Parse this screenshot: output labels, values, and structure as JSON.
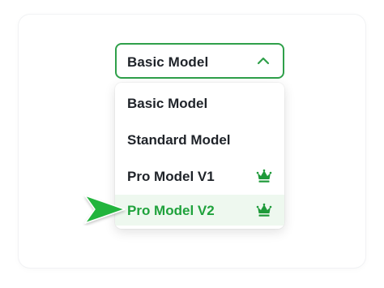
{
  "colors": {
    "accent": "#2fa04a",
    "selected_text": "#1fa23c",
    "selected_bg": "#eef8ef",
    "text": "#1f2329",
    "crown": "#1f9a3a"
  },
  "dropdown": {
    "value": "Basic Model",
    "expanded": true,
    "chevron_icon": "chevron-up-icon"
  },
  "options": [
    {
      "label": "Basic Model",
      "premium": false,
      "selected": false
    },
    {
      "label": "Standard Model",
      "premium": false,
      "selected": false
    },
    {
      "label": "Pro Model V1",
      "premium": true,
      "icon": "crown-icon",
      "selected": false
    },
    {
      "label": "Pro Model V2",
      "premium": true,
      "icon": "crown-icon",
      "selected": true
    }
  ],
  "pointer_icon": "pointer-arrow-icon"
}
